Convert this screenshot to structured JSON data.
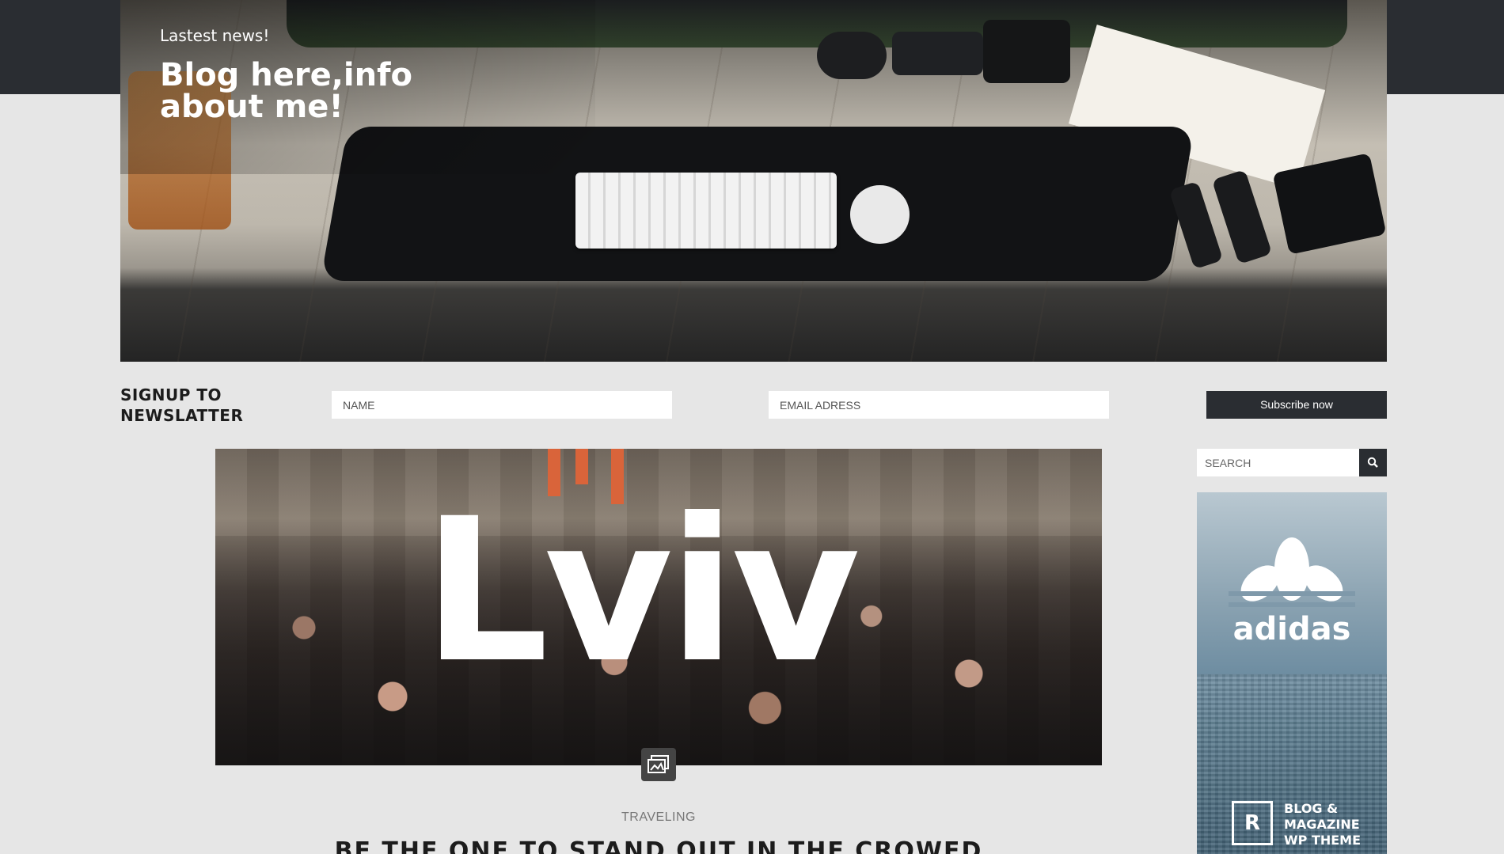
{
  "hero": {
    "kicker": "Lastest news!",
    "title": "Blog here,info about me!"
  },
  "newsletter": {
    "label": "SIGNUP TO NEWSLATTER",
    "name_placeholder": "NAME",
    "email_placeholder": "EMAIL ADRESS",
    "button_label": "Subscribe now"
  },
  "featured": {
    "image_word": "Lviv",
    "category": "TRAVELING",
    "title": "BE THE ONE TO STAND OUT IN THE CROWED"
  },
  "sidebar": {
    "search_placeholder": "SEARCH",
    "ad": {
      "brand": "adidas",
      "badge_letter": "R",
      "tagline": "BLOG & MAGAZINE WP THEME"
    }
  },
  "icons": {
    "search": "search-icon",
    "gallery": "image-gallery-icon",
    "logo": "adidas-trefoil-logo"
  },
  "colors": {
    "header_dark": "#2a2d32",
    "page_bg": "#e6e6e6",
    "button_bg": "#2a2d32"
  }
}
